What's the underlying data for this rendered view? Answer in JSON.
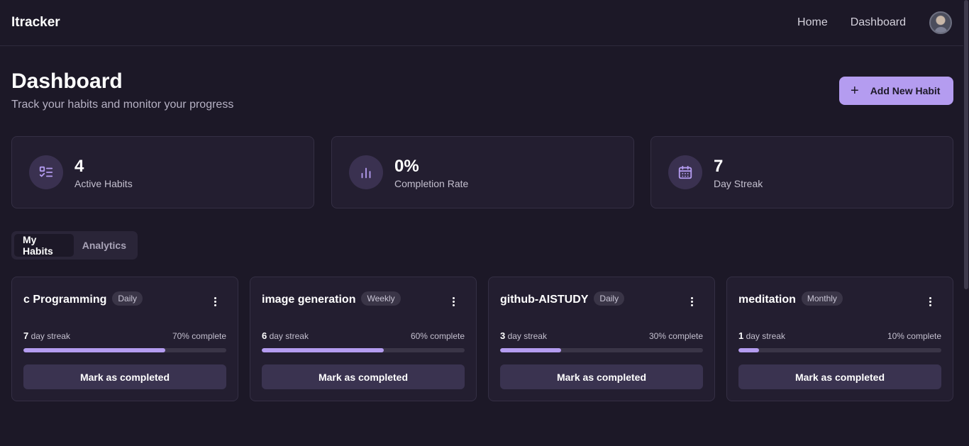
{
  "nav": {
    "brand": "Itracker",
    "links": [
      "Home",
      "Dashboard"
    ]
  },
  "page": {
    "title": "Dashboard",
    "subtitle": "Track your habits and monitor your progress",
    "add_button": "Add New Habit"
  },
  "stats": [
    {
      "value": "4",
      "label": "Active Habits",
      "icon": "list-check-icon"
    },
    {
      "value": "0%",
      "label": "Completion Rate",
      "icon": "bar-chart-icon"
    },
    {
      "value": "7",
      "label": "Day Streak",
      "icon": "calendar-icon"
    }
  ],
  "tabs": [
    "My Habits",
    "Analytics"
  ],
  "habits": [
    {
      "name": "c Programming",
      "frequency": "Daily",
      "streak": "7",
      "streak_suffix": "day streak",
      "complete": "70% complete",
      "progress": 0.7,
      "action": "Mark as completed"
    },
    {
      "name": "image generation",
      "frequency": "Weekly",
      "streak": "6",
      "streak_suffix": "day streak",
      "complete": "60% complete",
      "progress": 0.6,
      "action": "Mark as completed"
    },
    {
      "name": "github-AISTUDY",
      "frequency": "Daily",
      "streak": "3",
      "streak_suffix": "day streak",
      "complete": "30% complete",
      "progress": 0.3,
      "action": "Mark as completed"
    },
    {
      "name": "meditation",
      "frequency": "Monthly",
      "streak": "1",
      "streak_suffix": "day streak",
      "complete": "10% complete",
      "progress": 0.1,
      "action": "Mark as completed"
    }
  ],
  "colors": {
    "background": "#1c1827",
    "card": "#231e30",
    "accent": "#b49cf0"
  }
}
